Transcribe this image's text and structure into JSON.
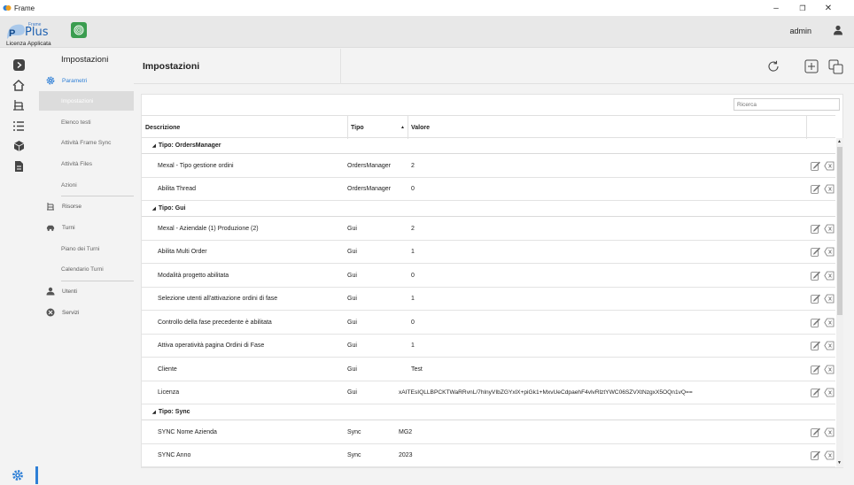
{
  "window": {
    "title": "Frame",
    "minimize": "–",
    "maximize": "❐",
    "close": "✕"
  },
  "header": {
    "logo_frame": "Frame",
    "logo_plus": "Plus",
    "logo_p": "P",
    "license_text": "Licenza Applicata",
    "user": "admin"
  },
  "nav": {
    "title": "Impostazioni",
    "items": [
      {
        "label": "Parametri"
      },
      {
        "label": "Impostazioni"
      },
      {
        "label": "Elenco testi"
      },
      {
        "label": "Attività Frame Sync"
      },
      {
        "label": "Attività Files"
      },
      {
        "label": "Azioni"
      },
      {
        "label": "Risorse"
      },
      {
        "label": "Turni"
      },
      {
        "label": "Piano dei Turni"
      },
      {
        "label": "Calendario Turni"
      },
      {
        "label": "Utenti"
      },
      {
        "label": "Servizi"
      }
    ]
  },
  "main": {
    "title": "Impostazioni",
    "search_placeholder": "Ricerca",
    "columns": {
      "descrizione": "Descrizione",
      "tipo": "Tipo",
      "sort_indicator": "▲",
      "valore": "Valore"
    },
    "groups": [
      {
        "label": "Tipo: OrdersManager",
        "rows": [
          {
            "descrizione": "Mexal - Tipo gestione ordini",
            "tipo": "OrdersManager",
            "valore": "2"
          },
          {
            "descrizione": "Abilita Thread",
            "tipo": "OrdersManager",
            "valore": "0"
          }
        ]
      },
      {
        "label": "Tipo: Gui",
        "rows": [
          {
            "descrizione": "Mexal - Aziendale (1) Produzione (2)",
            "tipo": "Gui",
            "valore": "2"
          },
          {
            "descrizione": "Abilita Multi Order",
            "tipo": "Gui",
            "valore": "1"
          },
          {
            "descrizione": "Modalità progetto abilitata",
            "tipo": "Gui",
            "valore": "0"
          },
          {
            "descrizione": "Selezione utenti all'attivazione ordini di fase",
            "tipo": "Gui",
            "valore": "1"
          },
          {
            "descrizione": "Controllo della fase precedente è abilitata",
            "tipo": "Gui",
            "valore": "0"
          },
          {
            "descrizione": "Attiva operatività pagina Ordini di Fase",
            "tipo": "Gui",
            "valore": "1"
          },
          {
            "descrizione": "Cliente",
            "tipo": "Gui",
            "valore": "Test"
          },
          {
            "descrizione": "Licenza",
            "tipo": "Gui",
            "valore": "xAITEsIQLLBPCKTWaRRvnL/7hlnyVIbZGYxlX+piGk1+MxvUeCdpaehF4vlvRlztYWC06SZVXtNzgxX5OQn1vQ=="
          }
        ]
      },
      {
        "label": "Tipo: Sync",
        "rows": [
          {
            "descrizione": "SYNC Nome Azienda",
            "tipo": "Sync",
            "valore": "MG2"
          },
          {
            "descrizione": "SYNC Anno",
            "tipo": "Sync",
            "valore": "2023"
          }
        ]
      }
    ]
  },
  "colors": {
    "accent": "#2e7fd6",
    "module_green": "#3b9d50"
  }
}
